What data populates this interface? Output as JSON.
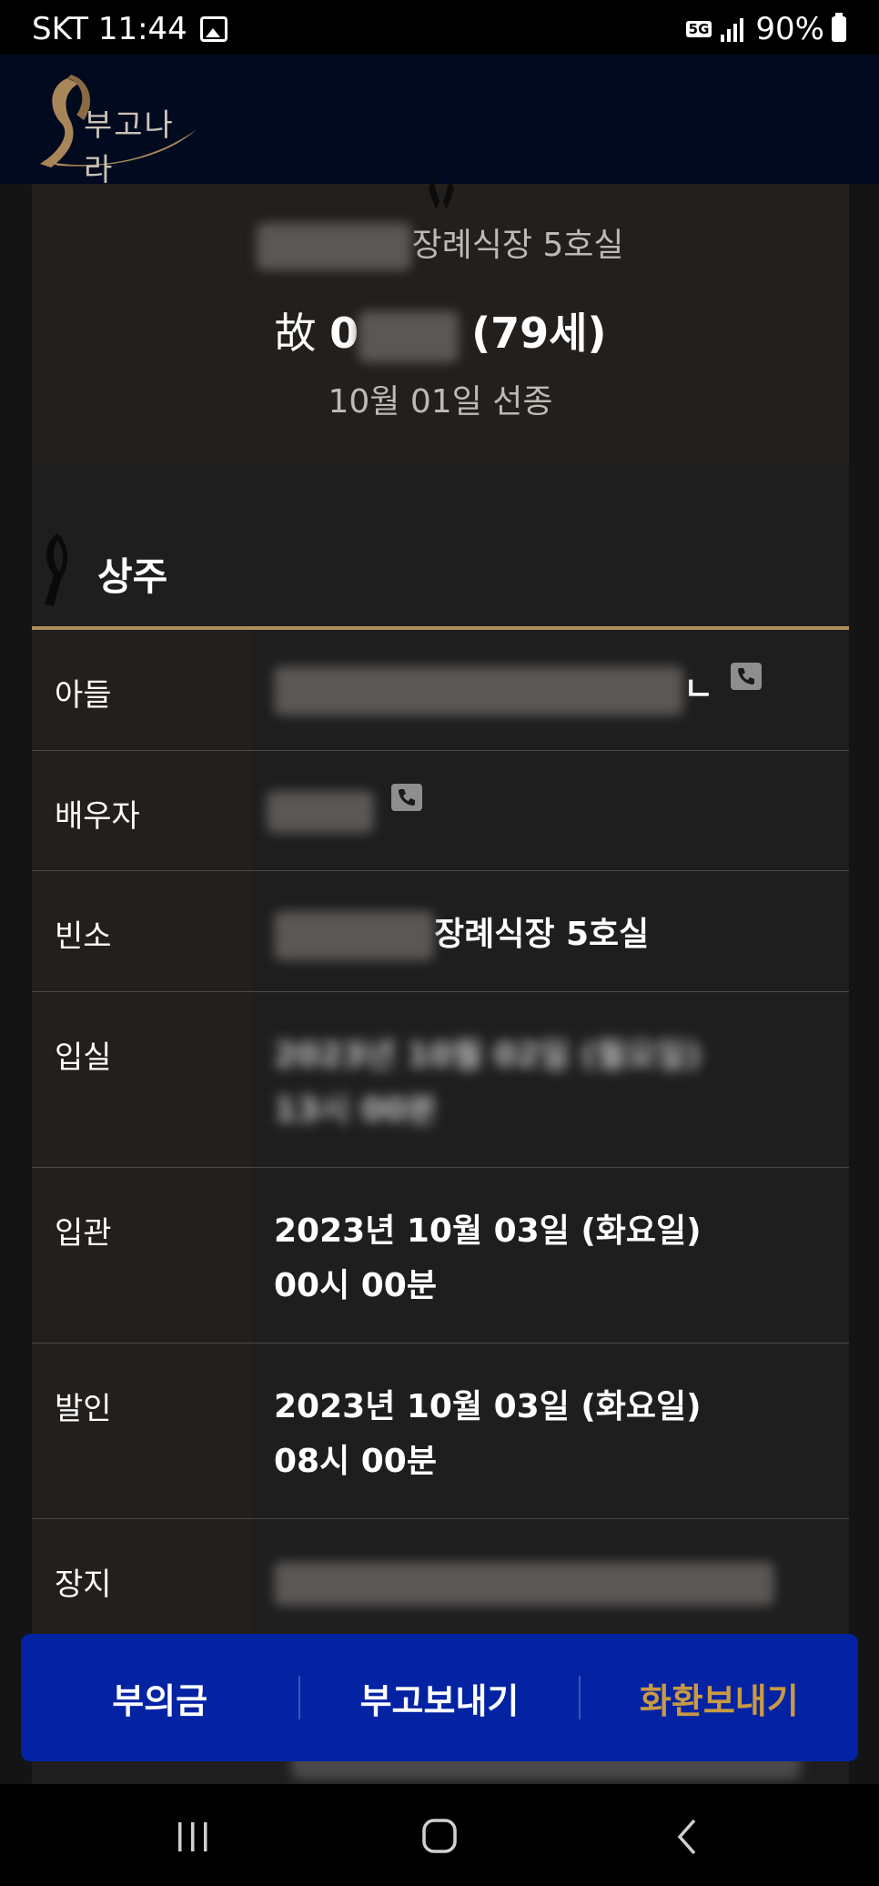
{
  "status_bar": {
    "carrier_time": "SKT 11:44",
    "network": "5G",
    "battery": "90%"
  },
  "header": {
    "logo_text": "부고나라"
  },
  "hero": {
    "venue_suffix": "장례식장 5호실",
    "name_prefix": "故 ",
    "name_initial": "0",
    "age": "(79세)",
    "death_date": "10월 01일 선종"
  },
  "section": {
    "title": "상주"
  },
  "rows": [
    {
      "label": "아들",
      "value_tail": "ㄴ"
    },
    {
      "label": "배우자"
    },
    {
      "label": "빈소",
      "value": "장례식장 5호실"
    },
    {
      "label": "입실",
      "value_line1": "2023년 10월 02일 (월요일)",
      "value_line2": "13시 00분"
    },
    {
      "label": "입관",
      "value_line1": "2023년 10월 03일 (화요일)",
      "value_line2": "00시 00분"
    },
    {
      "label": "발인",
      "value_line1": "2023년 10월 03일 (화요일)",
      "value_line2": "08시 00분"
    },
    {
      "label": "장지"
    }
  ],
  "actions": {
    "condolence_money": "부의금",
    "send_obituary": "부고보내기",
    "send_wreath": "화환보내기"
  },
  "colors": {
    "header_bg": "#010a1f",
    "action_bar_bg": "#0323a3",
    "gold_accent": "#b08e5b",
    "wreath_label": "#c99a43"
  }
}
